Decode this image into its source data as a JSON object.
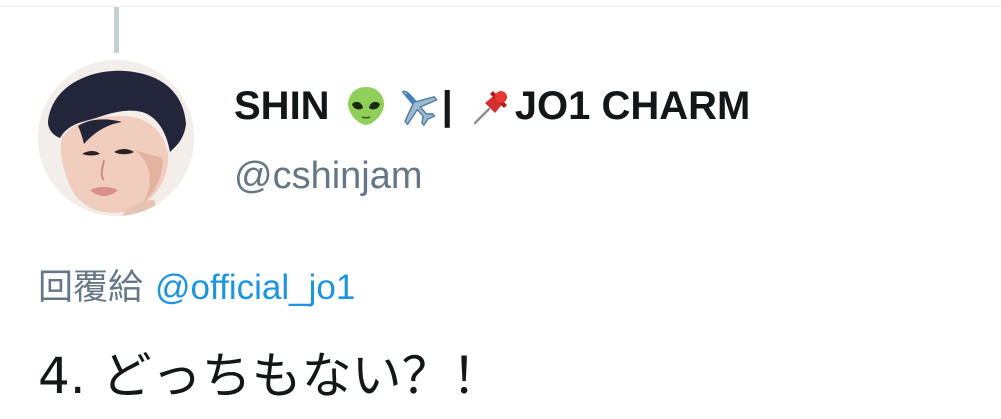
{
  "tweet": {
    "author": {
      "display_name_prefix": "SHIN",
      "display_name_separator": "|",
      "display_name_suffix": "JO1 CHARM",
      "display_name_emojis": [
        "alien-icon",
        "airplane-icon",
        "pushpin-icon"
      ],
      "handle": "@cshinjam"
    },
    "reply_to": {
      "label": "回覆給",
      "mention": "@official_jo1"
    },
    "text": "4. どっちもない？！"
  },
  "colors": {
    "primary_text": "#14171a",
    "secondary_text": "#657786",
    "link": "#1b95e0",
    "thread_line": "#c4cfd6",
    "divider": "#e6ecf0"
  }
}
